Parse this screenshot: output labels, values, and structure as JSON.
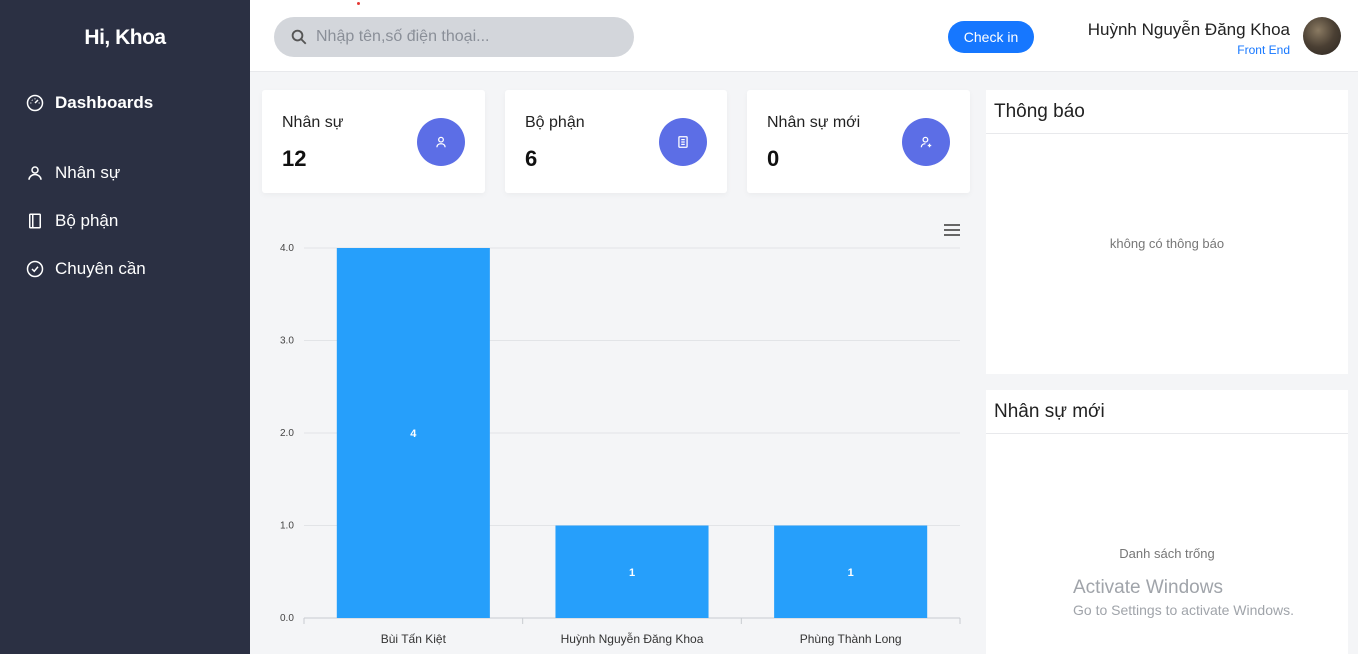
{
  "sidebar": {
    "greeting": "Hi, Khoa",
    "items": [
      {
        "label": "Dashboards",
        "icon": "dashboard-icon"
      },
      {
        "label": "Nhân sự",
        "icon": "user-icon"
      },
      {
        "label": "Bộ phận",
        "icon": "book-icon"
      },
      {
        "label": "Chuyên cần",
        "icon": "check-circle-icon"
      }
    ]
  },
  "header": {
    "search_placeholder": "Nhập tên,số điện thoại...",
    "checkin_label": "Check in",
    "user_name": "Huỳnh Nguyễn Đăng Khoa",
    "user_role": "Front End"
  },
  "stats": [
    {
      "label": "Nhân sự",
      "value": "12",
      "icon": "user-icon"
    },
    {
      "label": "Bộ phận",
      "value": "6",
      "icon": "document-icon"
    },
    {
      "label": "Nhân sự mới",
      "value": "0",
      "icon": "user-plus-icon"
    }
  ],
  "chart_data": {
    "type": "bar",
    "categories": [
      "Bùi Tấn Kiệt",
      "Huỳnh Nguyễn Đăng Khoa",
      "Phùng Thành Long"
    ],
    "values": [
      4,
      1,
      1
    ],
    "value_labels": [
      "4",
      "1",
      "1"
    ],
    "yticks": [
      "0.0",
      "1.0",
      "2.0",
      "3.0",
      "4.0"
    ],
    "ylim": [
      0,
      4
    ],
    "grid": true,
    "color": "#269ffb"
  },
  "panels": {
    "notify_title": "Thông báo",
    "notify_empty": "không có thông báo",
    "new_title": "Nhân sự mới",
    "new_empty": "Danh sách trống"
  },
  "watermark": {
    "line1": "Activate Windows",
    "line2": "Go to Settings to activate Windows."
  },
  "colors": {
    "sidebar_bg": "#2b3043",
    "accent": "#1677ff",
    "stat_icon_bg": "#5c6ee6"
  }
}
